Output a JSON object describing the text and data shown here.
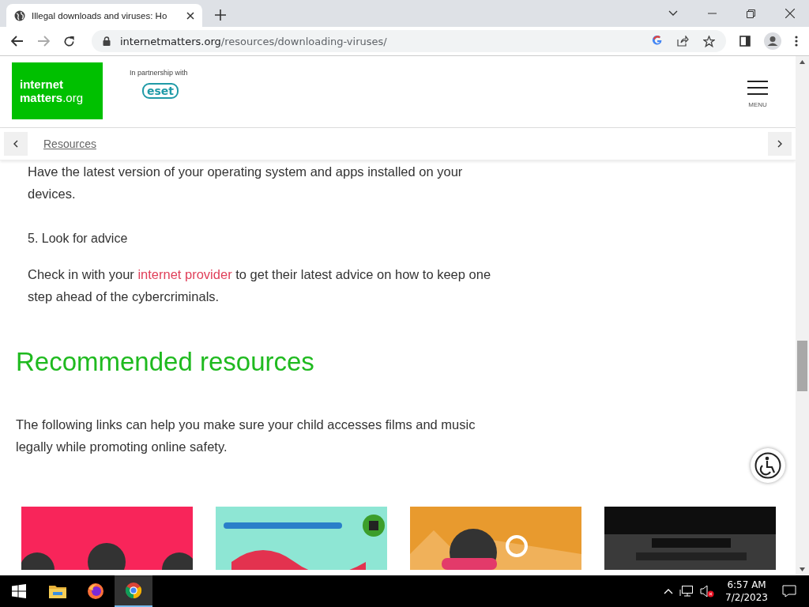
{
  "browser": {
    "tab_title": "Illegal downloads and viruses: Ho",
    "url_host": "internetmatters.org",
    "url_path": "/resources/downloading-viruses/"
  },
  "header": {
    "logo_line1": "internet",
    "logo_line2": "matters",
    "logo_suffix": ".org",
    "partner_label": "In partnership with",
    "partner_logo": "eset",
    "menu_label": "MENU"
  },
  "breadcrumb": {
    "items": [
      "Resources"
    ]
  },
  "article": [
    {
      "kind": "paragraph",
      "text": "Have the latest version of your operating system and apps installed on your devices."
    },
    {
      "kind": "subheading",
      "text": "5. Look for advice"
    },
    {
      "kind": "paragraph",
      "before": "Check in with your ",
      "link": "internet provider",
      "after": " to get their latest advice on how to keep one step ahead of the cybercriminals."
    }
  ],
  "recommended": {
    "title": "Recommended resources",
    "intro": "The following links can help you make sure your child accesses films and music legally while promoting online safety."
  },
  "taskbar": {
    "time": "6:57 AM",
    "date": "7/2/2023",
    "apps": [
      {
        "kind": "explorer",
        "selected": false
      },
      {
        "kind": "firefox",
        "selected": false
      },
      {
        "kind": "chrome",
        "selected": true
      }
    ]
  }
}
